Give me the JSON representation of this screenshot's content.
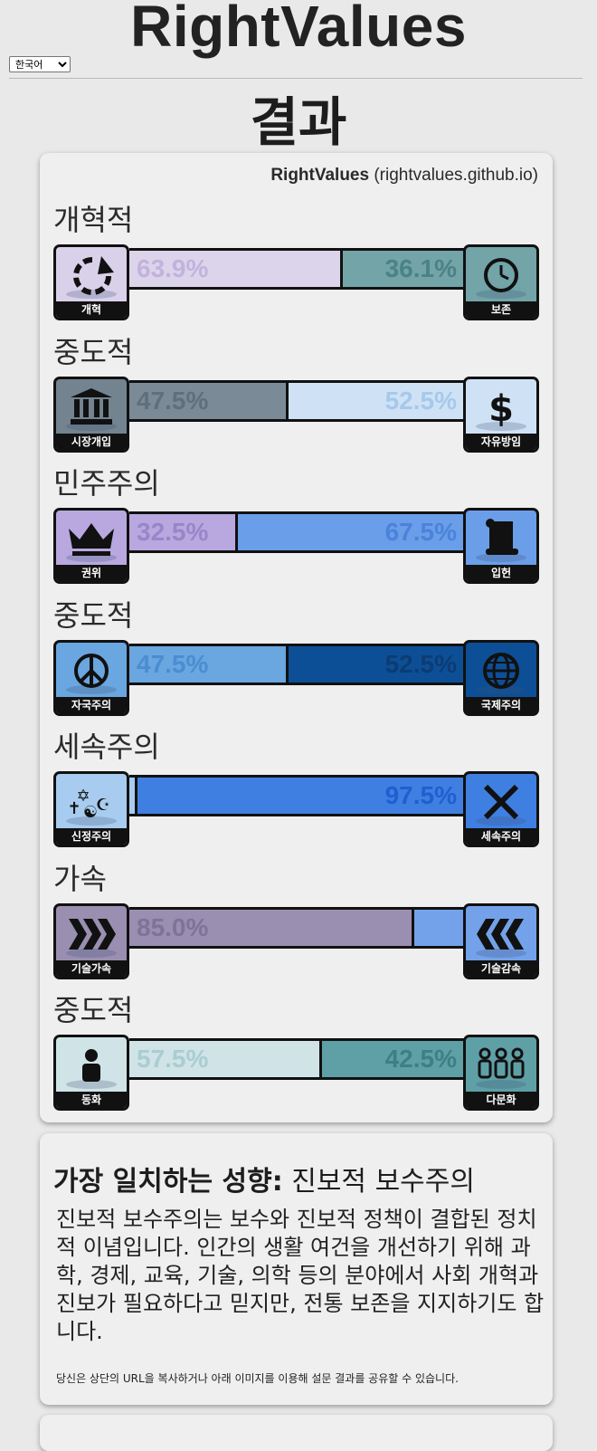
{
  "site_title": "RightValues",
  "language": {
    "selected": "한국어"
  },
  "page_title": "결과",
  "brand": {
    "name": "RightValues",
    "url": "(rightvalues.github.io)"
  },
  "axes": [
    {
      "label": "개혁적",
      "left": {
        "name": "개혁",
        "icon": "reform-arrow-icon",
        "percent": 63.9,
        "percent_text": "63.9%",
        "color": "#dcd4ea",
        "text_color": "#c1b3dd",
        "icon_bg": "#d9d0ea"
      },
      "right": {
        "name": "보존",
        "icon": "clock-icon",
        "percent": 36.1,
        "percent_text": "36.1%",
        "color": "#72a4a8",
        "text_color": "#4a8288",
        "icon_bg": "#72a4a8"
      }
    },
    {
      "label": "중도적",
      "left": {
        "name": "시장개입",
        "icon": "government-building-icon",
        "percent": 47.5,
        "percent_text": "47.5%",
        "color": "#7a8a96",
        "text_color": "#616f7a",
        "icon_bg": "#73838f"
      },
      "right": {
        "name": "자유방임",
        "icon": "dollar-icon",
        "percent": 52.5,
        "percent_text": "52.5%",
        "color": "#cfe2f5",
        "text_color": "#a6c8ea",
        "icon_bg": "#cfe2f5"
      }
    },
    {
      "label": "민주주의",
      "left": {
        "name": "권위",
        "icon": "crown-icon",
        "percent": 32.5,
        "percent_text": "32.5%",
        "color": "#b8a8df",
        "text_color": "#9786c8",
        "icon_bg": "#b8a8df"
      },
      "right": {
        "name": "입헌",
        "icon": "scroll-icon",
        "percent": 67.5,
        "percent_text": "67.5%",
        "color": "#6a9ee8",
        "text_color": "#4a83da",
        "icon_bg": "#6a9ee8"
      }
    },
    {
      "label": "중도적",
      "left": {
        "name": "자국주의",
        "icon": "peace-icon",
        "percent": 47.5,
        "percent_text": "47.5%",
        "color": "#6aa6e0",
        "text_color": "#4b8dd0",
        "icon_bg": "#6aa6e0"
      },
      "right": {
        "name": "국제주의",
        "icon": "globe-icon",
        "percent": 52.5,
        "percent_text": "52.5%",
        "color": "#0d4f96",
        "text_color": "#0b3c73",
        "icon_bg": "#0d4f96"
      }
    },
    {
      "label": "세속주의",
      "left": {
        "name": "신정주의",
        "icon": "religious-symbols-icon",
        "percent": 2.5,
        "percent_text": "",
        "color": "#a8ccef",
        "text_color": "#7fb0e3",
        "icon_bg": "#a8ccef"
      },
      "right": {
        "name": "세속주의",
        "icon": "cross-x-icon",
        "percent": 97.5,
        "percent_text": "97.5%",
        "color": "#3f7fe1",
        "text_color": "#1f5fd0",
        "icon_bg": "#3f7fe1"
      }
    },
    {
      "label": "가속",
      "left": {
        "name": "기술가속",
        "icon": "chevrons-right-icon",
        "percent": 85.0,
        "percent_text": "85.0%",
        "color": "#9a8fb0",
        "text_color": "#7f7399",
        "icon_bg": "#9a8fb0"
      },
      "right": {
        "name": "기술감속",
        "icon": "chevrons-left-icon",
        "percent": 15.0,
        "percent_text": "",
        "color": "#73a2ea",
        "text_color": "#4f86dc",
        "icon_bg": "#73a2ea"
      }
    },
    {
      "label": "중도적",
      "left": {
        "name": "동화",
        "icon": "person-icon",
        "percent": 57.5,
        "percent_text": "57.5%",
        "color": "#d0e3e6",
        "text_color": "#a9cdd2",
        "icon_bg": "#d0e3e6"
      },
      "right": {
        "name": "다문화",
        "icon": "group-people-icon",
        "percent": 42.5,
        "percent_text": "42.5%",
        "color": "#5fa0a6",
        "text_color": "#3c7f86",
        "icon_bg": "#5fa0a6"
      }
    }
  ],
  "ideology": {
    "heading_label": "가장 일치하는 성향:",
    "heading_value": "진보적 보수주의",
    "description": "진보적 보수주의는 보수와 진보적 정책이 결합된 정치적 이념입니다. 인간의 생활 여건을 개선하기 위해 과학, 경제, 교육, 기술, 의학 등의 분야에서 사회 개혁과 진보가 필요하다고 믿지만, 전통 보존을 지지하기도 합니다.",
    "share_note": "당신은 상단의 URL을 복사하거나 아래 이미지를 이용해 설문 결과를 공유할 수 있습니다."
  }
}
